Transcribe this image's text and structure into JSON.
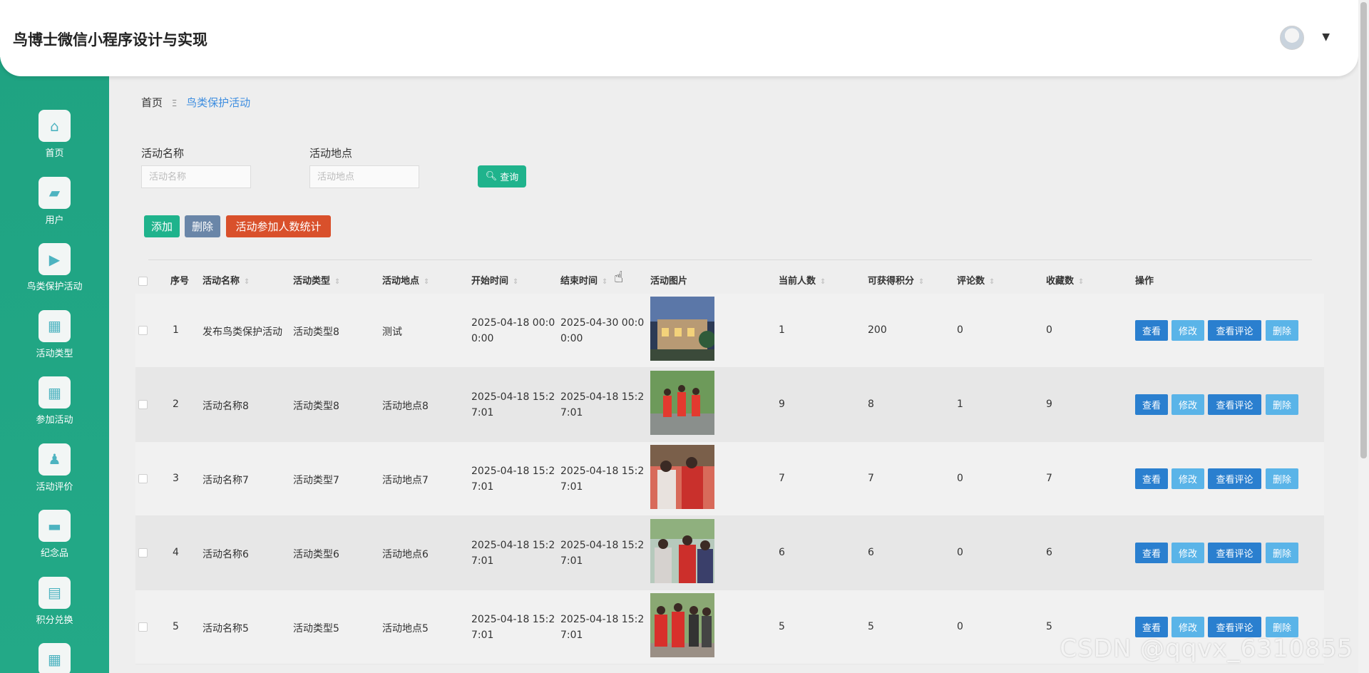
{
  "header": {
    "app_title": "鸟博士微信小程序设计与实现",
    "caret": "▼"
  },
  "sidebar": {
    "items": [
      {
        "label": "首页",
        "icon": "home-icon",
        "glyph": "⌂"
      },
      {
        "label": "用户",
        "icon": "briefcase-icon",
        "glyph": "▰"
      },
      {
        "label": "鸟类保护活动",
        "icon": "ticket-icon",
        "glyph": "▶"
      },
      {
        "label": "活动类型",
        "icon": "grid-icon",
        "glyph": "▦"
      },
      {
        "label": "参加活动",
        "icon": "grid-icon",
        "glyph": "▦"
      },
      {
        "label": "活动评价",
        "icon": "user-icon",
        "glyph": "♟"
      },
      {
        "label": "纪念品",
        "icon": "chat-icon",
        "glyph": "▬"
      },
      {
        "label": "积分兑换",
        "icon": "clipboard-icon",
        "glyph": "▤"
      },
      {
        "label": "",
        "icon": "grid-icon",
        "glyph": "▦"
      }
    ]
  },
  "breadcrumb": {
    "home": "首页",
    "separator": "Ξ",
    "current": "鸟类保护活动"
  },
  "search": {
    "name_label": "活动名称",
    "name_placeholder": "活动名称",
    "location_label": "活动地点",
    "location_placeholder": "活动地点",
    "query_label": "查询"
  },
  "actions": {
    "add": "添加",
    "delete": "删除",
    "stats": "活动参加人数统计"
  },
  "table": {
    "headers": [
      "序号",
      "活动名称",
      "活动类型",
      "活动地点",
      "开始时间",
      "结束时间",
      "活动图片",
      "当前人数",
      "可获得积分",
      "评论数",
      "收藏数",
      "操作"
    ],
    "sort_glyph": "⇕",
    "rows": [
      {
        "index": "1",
        "name": "发布鸟类保护活动",
        "type": "活动类型8",
        "location": "测试",
        "start": "2025-04-18 00:00:00",
        "end": "2025-04-30 00:00:00",
        "people": "1",
        "points": "200",
        "comments": "0",
        "favorites": "0"
      },
      {
        "index": "2",
        "name": "活动名称8",
        "type": "活动类型8",
        "location": "活动地点8",
        "start": "2025-04-18 15:27:01",
        "end": "2025-04-18 15:27:01",
        "people": "9",
        "points": "8",
        "comments": "1",
        "favorites": "9"
      },
      {
        "index": "3",
        "name": "活动名称7",
        "type": "活动类型7",
        "location": "活动地点7",
        "start": "2025-04-18 15:27:01",
        "end": "2025-04-18 15:27:01",
        "people": "7",
        "points": "7",
        "comments": "0",
        "favorites": "7"
      },
      {
        "index": "4",
        "name": "活动名称6",
        "type": "活动类型6",
        "location": "活动地点6",
        "start": "2025-04-18 15:27:01",
        "end": "2025-04-18 15:27:01",
        "people": "6",
        "points": "6",
        "comments": "0",
        "favorites": "6"
      },
      {
        "index": "5",
        "name": "活动名称5",
        "type": "活动类型5",
        "location": "活动地点5",
        "start": "2025-04-18 15:27:01",
        "end": "2025-04-18 15:27:01",
        "people": "5",
        "points": "5",
        "comments": "0",
        "favorites": "5"
      }
    ],
    "row_buttons": {
      "view": "查看",
      "edit": "修改",
      "view_comments": "查看评论",
      "delete": "删除"
    }
  },
  "watermark": "CSDN @qqvx_6310855",
  "colors": {
    "sidebar": "#1fa382",
    "primary_green": "#1fb38c",
    "btn_blue": "#2a7fcf",
    "btn_light_blue": "#5ab4e8",
    "btn_gray_blue": "#6a86a8",
    "btn_red": "#d9502b",
    "link_blue": "#3e8ee0"
  }
}
